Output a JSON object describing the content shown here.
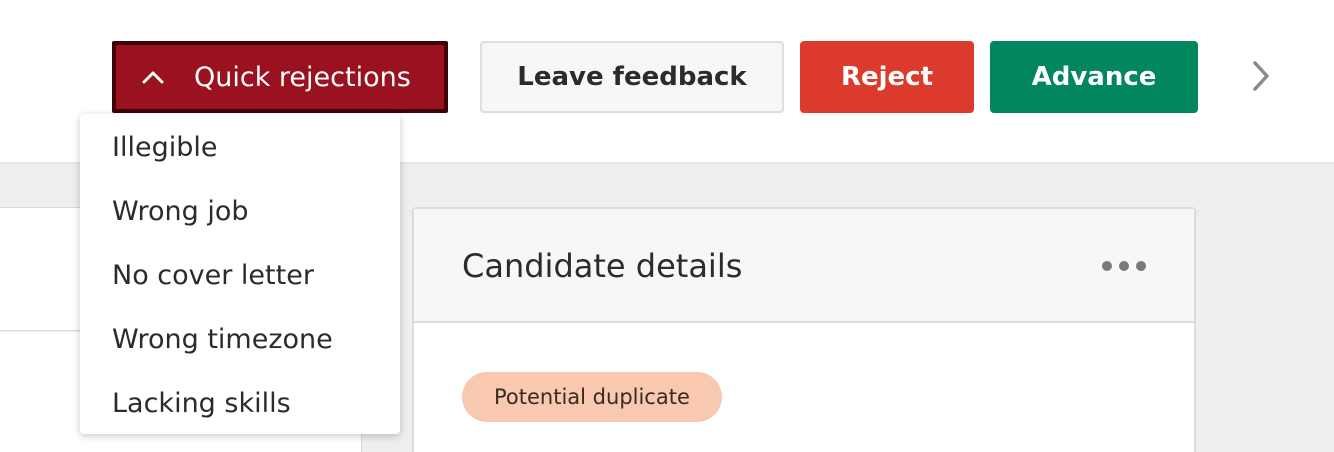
{
  "toolbar": {
    "quick_rejections_label": "Quick rejections",
    "leave_feedback_label": "Leave feedback",
    "reject_label": "Reject",
    "advance_label": "Advance"
  },
  "quick_rejections_menu": {
    "items": [
      "Illegible",
      "Wrong job",
      "No cover letter",
      "Wrong timezone",
      "Lacking skills"
    ]
  },
  "candidate_card": {
    "title": "Candidate details",
    "badge": "Potential duplicate"
  },
  "colors": {
    "quick_rejections_bg": "#9a111f",
    "reject_bg": "#dc3a2c",
    "advance_bg": "#028660",
    "badge_bg": "#f8c8b1"
  },
  "icons": {
    "quick_rejections": "chevron-up-icon",
    "next": "chevron-right-icon",
    "more": "more-horizontal-icon"
  }
}
